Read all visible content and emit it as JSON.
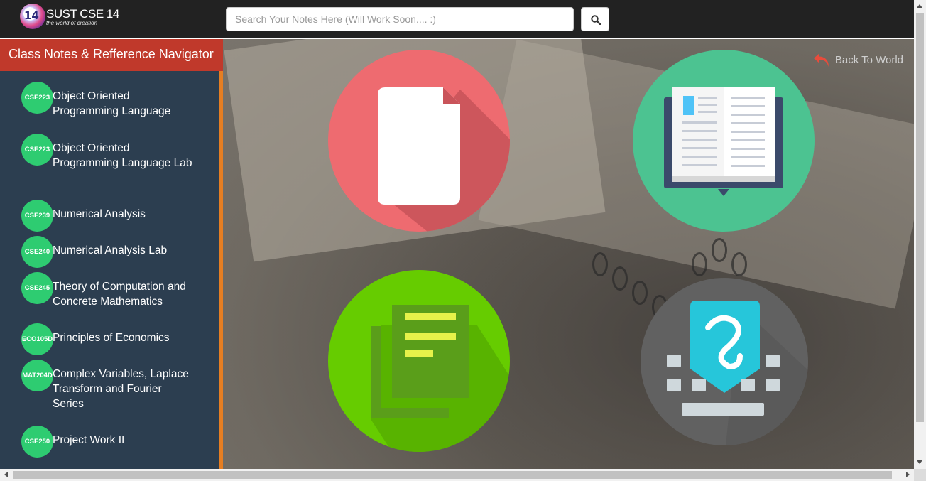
{
  "header": {
    "logo_number": "14",
    "logo_title": "SUST CSE 14",
    "logo_subtitle": "the world of creation",
    "search_placeholder": "Search Your Notes Here (Will Work Soon.... :)",
    "search_button_icon": "search-icon"
  },
  "sidebar": {
    "title": "Class Notes & Refference Navigator",
    "courses": [
      {
        "code": "CSE223",
        "name": "Object Oriented Programming Language"
      },
      {
        "code": "CSE223",
        "name": "Object Oriented Programming Language Lab"
      },
      {
        "code": "CSE239",
        "name": "Numerical Analysis"
      },
      {
        "code": "CSE240",
        "name": "Numerical Analysis Lab"
      },
      {
        "code": "CSE245",
        "name": "Theory of Computation and Concrete Mathematics"
      },
      {
        "code": "ECO105D",
        "name": "Principles of Economics"
      },
      {
        "code": "MAT204D",
        "name": "Complex Variables, Laplace Transform and Fourier Series"
      },
      {
        "code": "CSE250",
        "name": "Project Work II"
      }
    ]
  },
  "main": {
    "back_link": "Back To World",
    "back_icon": "reply-arrow-icon",
    "tiles": [
      {
        "icon": "document-icon",
        "color": "#ee6b70"
      },
      {
        "icon": "open-book-icon",
        "color": "#4cc391"
      },
      {
        "icon": "documents-stack-icon",
        "color": "#66cc00"
      },
      {
        "icon": "handwriting-keyboard-icon",
        "color": "#616161"
      }
    ]
  },
  "colors": {
    "navbar": "#222222",
    "sidebar": "#2c3e50",
    "sidebar_title": "#c0392b",
    "sidebar_accent": "#e67e22",
    "course_badge": "#2ecc71"
  }
}
